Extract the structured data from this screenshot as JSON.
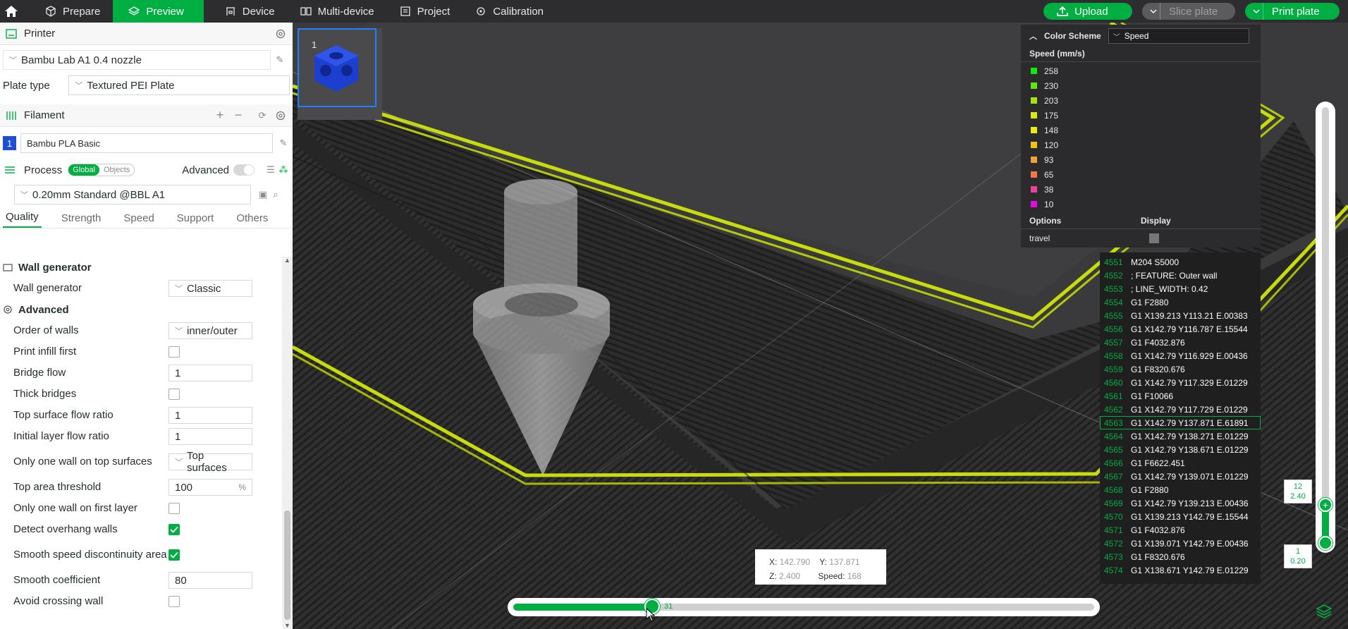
{
  "topbar": {
    "tabs": [
      {
        "label": "Prepare",
        "icon": "cube-icon"
      },
      {
        "label": "Preview",
        "icon": "layers-icon"
      },
      {
        "label": "Device",
        "icon": "printer-icon"
      },
      {
        "label": "Multi-device",
        "icon": "multi-device-icon"
      },
      {
        "label": "Project",
        "icon": "project-icon"
      },
      {
        "label": "Calibration",
        "icon": "calibration-icon"
      }
    ],
    "active_tab": "Preview",
    "upload_label": "Upload",
    "slice_label": "Slice plate",
    "print_label": "Print plate"
  },
  "printer": {
    "title": "Printer",
    "name": "Bambu Lab A1 0.4 nozzle",
    "plate_type_label": "Plate type",
    "plate_type_value": "Textured PEI Plate"
  },
  "filament": {
    "title": "Filament",
    "slot_number": "1",
    "slot_color": "#1e4fd8",
    "name": "Bambu PLA Basic"
  },
  "process": {
    "title": "Process",
    "toggle_global": "Global",
    "toggle_objects": "Objects",
    "advanced_label": "Advanced",
    "preset": "0.20mm Standard @BBL A1",
    "tabs": [
      "Quality",
      "Strength",
      "Speed",
      "Support",
      "Others"
    ],
    "active_tab": "Quality"
  },
  "options": {
    "wall_generator_section": "Wall generator",
    "wall_generator_label": "Wall generator",
    "wall_generator_value": "Classic",
    "advanced_section": "Advanced",
    "order_of_walls_label": "Order of walls",
    "order_of_walls_value": "inner/outer",
    "print_infill_first_label": "Print infill first",
    "bridge_flow_label": "Bridge flow",
    "bridge_flow_value": "1",
    "thick_bridges_label": "Thick bridges",
    "top_surface_flow_label": "Top surface flow ratio",
    "top_surface_flow_value": "1",
    "initial_layer_flow_label": "Initial layer flow ratio",
    "initial_layer_flow_value": "1",
    "one_wall_top_label": "Only one wall on top surfaces",
    "one_wall_top_value": "Top surfaces",
    "top_area_threshold_label": "Top area threshold",
    "top_area_threshold_value": "100",
    "top_area_threshold_unit": "%",
    "one_wall_first_label": "Only one wall on first layer",
    "detect_overhang_label": "Detect overhang walls",
    "smooth_speed_label": "Smooth speed discontinuity area",
    "smooth_coef_label": "Smooth coefficient",
    "smooth_coef_value": "80",
    "avoid_crossing_label": "Avoid crossing wall"
  },
  "plate_thumbnail": {
    "number": "1"
  },
  "legend": {
    "color_scheme_label": "Color Scheme",
    "color_scheme_value": "Speed",
    "title": "Speed (mm/s)",
    "items": [
      {
        "value": "258",
        "color": "#12e80e"
      },
      {
        "value": "230",
        "color": "#5fe80e"
      },
      {
        "value": "203",
        "color": "#a6e30e"
      },
      {
        "value": "175",
        "color": "#d9e80e"
      },
      {
        "value": "148",
        "color": "#f0ea0e"
      },
      {
        "value": "120",
        "color": "#f2c40e"
      },
      {
        "value": "93",
        "color": "#f2a23a"
      },
      {
        "value": "65",
        "color": "#f0784e"
      },
      {
        "value": "38",
        "color": "#e8449a"
      },
      {
        "value": "10",
        "color": "#e00ee0"
      }
    ],
    "options_label": "Options",
    "display_label": "Display",
    "travel_label": "travel"
  },
  "gcode": {
    "lines": [
      {
        "num": "4551",
        "text": "M204 S5000"
      },
      {
        "num": "4552",
        "text": "; FEATURE: Outer wall"
      },
      {
        "num": "4553",
        "text": "; LINE_WIDTH: 0.42"
      },
      {
        "num": "4554",
        "text": "G1 F2880"
      },
      {
        "num": "4555",
        "text": "G1 X139.213 Y113.21 E.00383"
      },
      {
        "num": "4556",
        "text": "G1 X142.79 Y116.787 E.15544"
      },
      {
        "num": "4557",
        "text": "G1 F4032.876"
      },
      {
        "num": "4558",
        "text": "G1 X142.79 Y116.929 E.00436"
      },
      {
        "num": "4559",
        "text": "G1 F8320.676"
      },
      {
        "num": "4560",
        "text": "G1 X142.79 Y117.329 E.01229"
      },
      {
        "num": "4561",
        "text": "G1 F10066"
      },
      {
        "num": "4562",
        "text": "G1 X142.79 Y117.729 E.01229"
      },
      {
        "num": "4563",
        "text": "G1 X142.79 Y137.871 E.61891"
      },
      {
        "num": "4564",
        "text": "G1 X142.79 Y138.271 E.01229"
      },
      {
        "num": "4565",
        "text": "G1 X142.79 Y138.671 E.01229"
      },
      {
        "num": "4566",
        "text": "G1 F6622.451"
      },
      {
        "num": "4567",
        "text": "G1 X142.79 Y139.071 E.01229"
      },
      {
        "num": "4568",
        "text": "G1 F2880"
      },
      {
        "num": "4569",
        "text": "G1 X142.79 Y139.213 E.00436"
      },
      {
        "num": "4570",
        "text": "G1 X139.213 Y142.79 E.15544"
      },
      {
        "num": "4571",
        "text": "G1 F4032.876"
      },
      {
        "num": "4572",
        "text": "G1 X139.071 Y142.79 E.00436"
      },
      {
        "num": "4573",
        "text": "G1 F8320.676"
      },
      {
        "num": "4574",
        "text": "G1 X138.671 Y142.79 E.01229"
      }
    ],
    "selected_num": "4563"
  },
  "layer_slider": {
    "top_layer": "12",
    "top_height": "2.40",
    "bottom_layer": "1",
    "bottom_height": "0.20"
  },
  "move_slider": {
    "value": "31",
    "fraction": 0.24
  },
  "coords": {
    "x_label": "X:",
    "x_value": "142.790",
    "y_label": "Y:",
    "y_value": "137.871",
    "z_label": "Z:",
    "z_value": "2.400",
    "speed_label": "Speed:",
    "speed_value": "168"
  }
}
